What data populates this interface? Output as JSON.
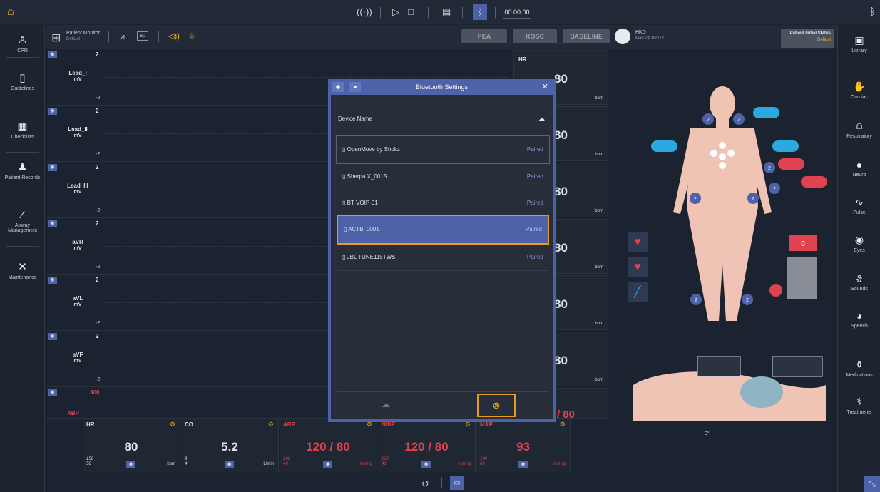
{
  "timer": "00:00:00",
  "left_nav": [
    {
      "label": "CPR",
      "icon": "cpr-icon"
    },
    {
      "label": "Guidelines",
      "icon": "document-icon"
    },
    {
      "label": "Checklists",
      "icon": "clipboard-icon"
    },
    {
      "label": "Patient Records",
      "icon": "person-icon"
    },
    {
      "label": "Airway Management",
      "icon": "airway-icon"
    },
    {
      "label": "Maintenance",
      "icon": "tools-icon"
    }
  ],
  "right_nav": [
    {
      "label": "Library",
      "icon": "library-icon"
    },
    {
      "label": "Cardiac",
      "icon": "hand-icon"
    },
    {
      "label": "Respiratory",
      "icon": "lungs-icon"
    },
    {
      "label": "Neuro",
      "icon": "brain-icon"
    },
    {
      "label": "Pulse",
      "icon": "pulse-icon"
    },
    {
      "label": "Eyes",
      "icon": "eye-icon"
    },
    {
      "label": "Sounds",
      "icon": "stethoscope-icon"
    },
    {
      "label": "Speech",
      "icon": "speech-icon"
    },
    {
      "label": "Medications",
      "icon": "medication-icon"
    },
    {
      "label": "Treatments",
      "icon": "treatment-icon"
    }
  ],
  "monitor": {
    "title": "Patient Monitor",
    "subtitle": "Default",
    "toggle_value": "80"
  },
  "buttons": {
    "pea": "PEA",
    "rosc": "ROSC",
    "baseline": "BASELINE"
  },
  "patient": {
    "name": "HKD",
    "info": "Man 24 180/72"
  },
  "initial_status": {
    "label": "Patient Initial Status",
    "value": "Default"
  },
  "waves": [
    {
      "label": "Lead_I",
      "unit": "mV",
      "top": "2",
      "bottom": "-2"
    },
    {
      "label": "Lead_II",
      "unit": "mV",
      "top": "2",
      "bottom": "-2"
    },
    {
      "label": "Lead_III",
      "unit": "mV",
      "top": "2",
      "bottom": "-2"
    },
    {
      "label": "aVR",
      "unit": "mV",
      "top": "2",
      "bottom": "-2"
    },
    {
      "label": "aVL",
      "unit": "mV",
      "top": "2",
      "bottom": "-2"
    },
    {
      "label": "aVF",
      "unit": "mV",
      "top": "2",
      "bottom": "-2"
    },
    {
      "label": "ABP",
      "unit": "",
      "top": "300",
      "bottom": ""
    }
  ],
  "vitals_right": {
    "hr_label": "HR",
    "value": "80",
    "unit": "bpm",
    "partial": "/ 80"
  },
  "tiles": [
    {
      "title": "HR",
      "value": "80",
      "hi": "150",
      "lo": "50",
      "unit": "bpm"
    },
    {
      "title": "CO",
      "value": "5.2",
      "hi": "9",
      "lo": "4",
      "unit": "L/min"
    },
    {
      "title": "ABP",
      "value": "120 / 80",
      "hi": "160",
      "lo": "40",
      "unit": "mmHg"
    },
    {
      "title": "NIBP",
      "value": "120 / 80",
      "hi": "160",
      "lo": "40",
      "unit": "mmHg"
    },
    {
      "title": "MAP",
      "value": "93",
      "hi": "100",
      "lo": "60",
      "unit": "mmHg"
    }
  ],
  "bluetooth": {
    "title": "Bluetooth Settings",
    "column": "Device Name",
    "devices": [
      {
        "name": "OpenMove by Shokz",
        "status": "Paired"
      },
      {
        "name": "Sherpa X_0015",
        "status": "Paired"
      },
      {
        "name": "BT-VOIP-01",
        "status": "Paired"
      },
      {
        "name": "ACTB_0001",
        "status": "Paired"
      },
      {
        "name": "JBL TUNE115TWS",
        "status": "Paired"
      }
    ]
  },
  "anatomy": {
    "badge": "2",
    "counter": "0",
    "angle": "0°"
  },
  "colors": {
    "accent": "#4d62a8",
    "warning": "#e0424f",
    "highlight": "#e89a1e",
    "gear": "#d5a22a"
  }
}
